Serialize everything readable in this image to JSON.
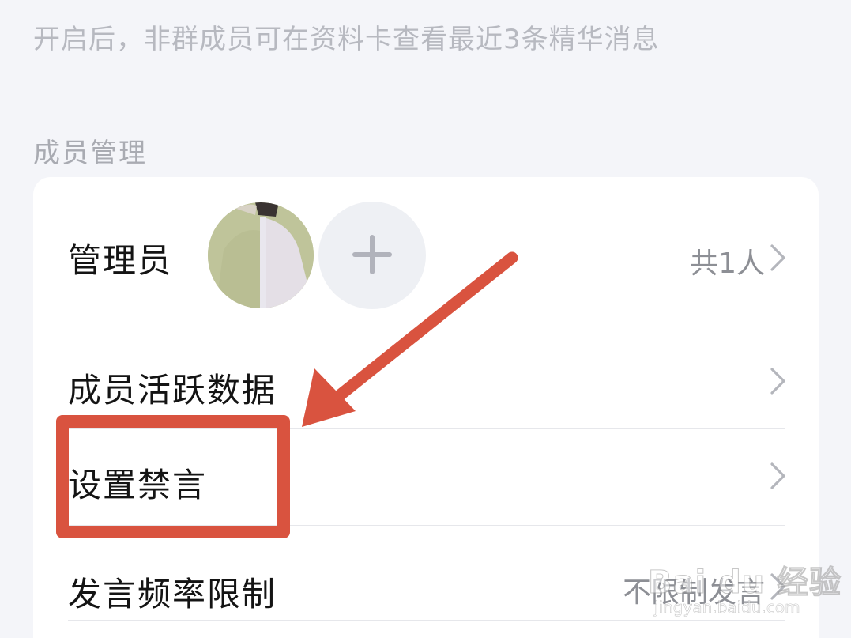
{
  "hint": {
    "text": "开启后，非群成员可在资料卡查看最近3条精华消息"
  },
  "member_management": {
    "section_title": "成员管理",
    "admin": {
      "label": "管理员",
      "count_text": "共1人"
    },
    "activity": {
      "label": "成员活跃数据"
    },
    "mute": {
      "label": "设置禁言"
    },
    "frequency": {
      "label": "发言频率限制",
      "value": "不限制发言"
    }
  },
  "icons": {
    "chevron": "chevron-right-icon",
    "add": "plus-icon"
  },
  "colors": {
    "annotation": "#d9533f",
    "background": "#f4f5f9",
    "card": "#ffffff"
  },
  "watermark": {
    "brand": "Bai du 经验",
    "url": "jingyan.baidu.com"
  }
}
